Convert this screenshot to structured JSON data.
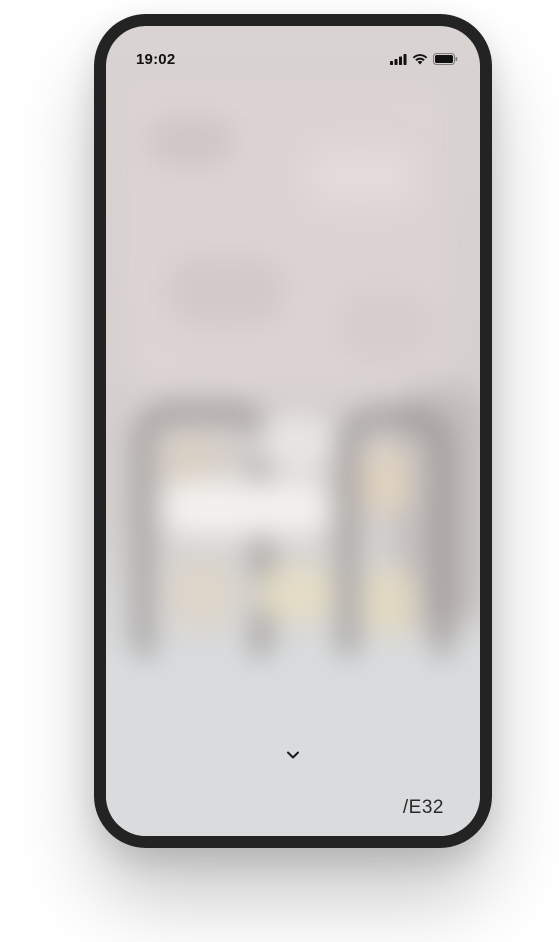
{
  "status_bar": {
    "time": "19:02",
    "icons": [
      "cellular-signal-icon",
      "wifi-icon",
      "battery-icon"
    ]
  },
  "main": {
    "scroll_icon": "chevron-down-icon",
    "brand_label": "/E32"
  },
  "colors": {
    "device_frame": "#232323",
    "screen_backdrop": "#d8d3d2",
    "text": "#2a2a2a"
  }
}
